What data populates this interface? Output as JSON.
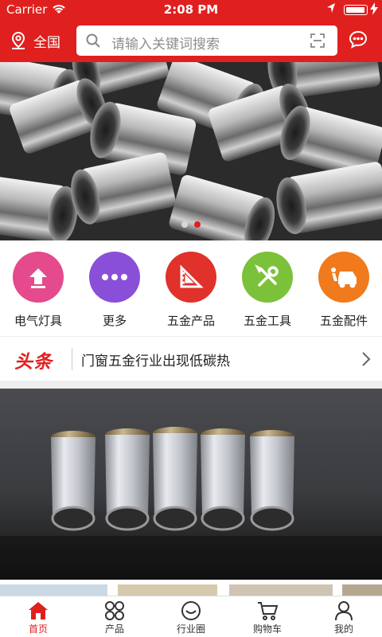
{
  "status_bar": {
    "carrier": "Carrier",
    "time": "2:08 PM"
  },
  "header": {
    "location_label": "全国",
    "search_placeholder": "请输入关键词搜索"
  },
  "banner": {
    "slide_count": 2,
    "active_slide": 2
  },
  "categories": [
    {
      "label": "电气灯具",
      "color": "#e44a8c",
      "icon": "upload-arrow-icon"
    },
    {
      "label": "更多",
      "color": "#8a4fd8",
      "icon": "more-dots-icon"
    },
    {
      "label": "五金产品",
      "color": "#e0312b",
      "icon": "set-square-icon"
    },
    {
      "label": "五金工具",
      "color": "#7cc13a",
      "icon": "wrench-screwdriver-icon"
    },
    {
      "label": "五金配件",
      "color": "#f07a1c",
      "icon": "car-repair-icon"
    }
  ],
  "headline": {
    "tag": "头条",
    "text": "门窗五金行业出现低碳热"
  },
  "tabbar": [
    {
      "label": "首页",
      "icon": "home-icon",
      "active": true
    },
    {
      "label": "产品",
      "icon": "grid-icon",
      "active": false
    },
    {
      "label": "行业圈",
      "icon": "smile-circle-icon",
      "active": false
    },
    {
      "label": "购物车",
      "icon": "cart-icon",
      "active": false
    },
    {
      "label": "我的",
      "icon": "user-icon",
      "active": false
    }
  ],
  "colors": {
    "brand": "#e0201e"
  }
}
